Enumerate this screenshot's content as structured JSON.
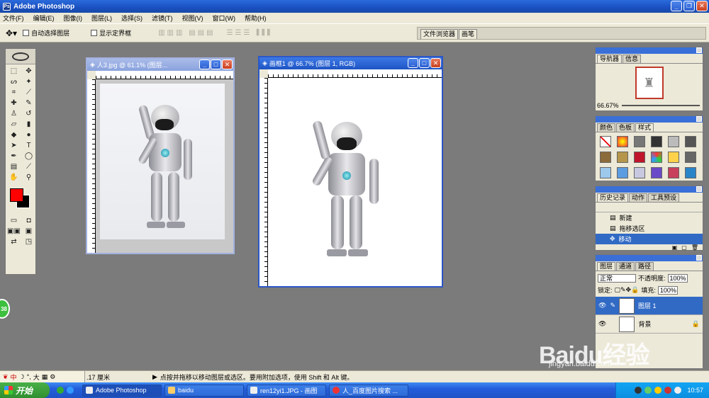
{
  "app": {
    "title": "Adobe Photoshop"
  },
  "menu": [
    "文件(F)",
    "编辑(E)",
    "图像(I)",
    "图层(L)",
    "选择(S)",
    "滤镜(T)",
    "视图(V)",
    "窗口(W)",
    "帮助(H)"
  ],
  "options": {
    "auto_select_label": "自动选择图层",
    "show_bounds_label": "显示定界框",
    "well_tabs": [
      "文件浏览器",
      "画笔"
    ]
  },
  "doc1": {
    "title": "人3.jpg @ 61.1% (图层..."
  },
  "doc2": {
    "title": "画框1 @ 66.7% (图层 1, RGB)"
  },
  "navigator": {
    "tabs": [
      "导航器",
      "信息"
    ],
    "zoom": "66.67%"
  },
  "swatch_panel": {
    "tabs": [
      "颜色",
      "色板",
      "样式"
    ]
  },
  "history": {
    "tabs": [
      "历史记录",
      "动作",
      "工具预设"
    ],
    "items": [
      {
        "label": "新建"
      },
      {
        "label": "拖移选区"
      },
      {
        "label": "移动"
      }
    ]
  },
  "layers": {
    "tabs": [
      "图层",
      "通道",
      "路径"
    ],
    "blend_mode": "正常",
    "opacity_label": "不透明度:",
    "opacity": "100%",
    "lock_label": "锁定:",
    "fill_label": "填充:",
    "fill": "100%",
    "items": [
      {
        "name": "图层 1"
      },
      {
        "name": "背景"
      }
    ]
  },
  "status": {
    "ime": "中",
    "ime_size": "大",
    "unit": ".17 厘米",
    "message": "点按并拖移以移动图层或选区。要用附加选项，使用 Shift 和 Alt 键。"
  },
  "taskbar": {
    "start": "开始",
    "tasks": [
      "Adobe Photoshop",
      "baidu",
      "ren12yi1.JPG - 画图",
      "人_百度图片搜索 ..."
    ],
    "clock": "10:57"
  },
  "watermark": {
    "brand": "Baidu经验",
    "url": "jingyan.baidu.com"
  },
  "side_badge": "38",
  "colors": {
    "foreground": "#ff0000",
    "background": "#000000",
    "accent": "#316ac5"
  }
}
